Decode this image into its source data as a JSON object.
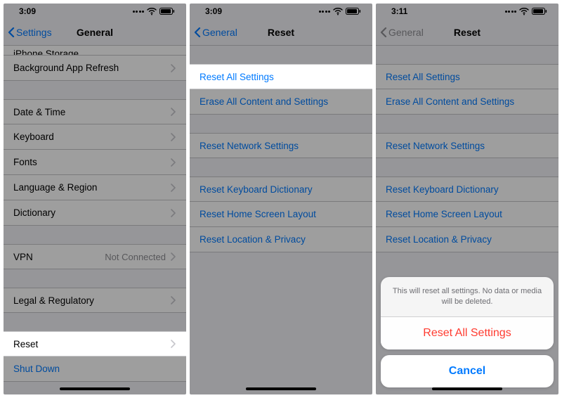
{
  "panel1": {
    "time": "3:09",
    "back_label": "Settings",
    "title": "General",
    "rows": {
      "clipped": "iPhone Storage",
      "bg_refresh": "Background App Refresh",
      "date_time": "Date & Time",
      "keyboard": "Keyboard",
      "fonts": "Fonts",
      "lang_region": "Language & Region",
      "dictionary": "Dictionary",
      "vpn": "VPN",
      "vpn_detail": "Not Connected",
      "legal": "Legal & Regulatory",
      "reset": "Reset",
      "shutdown": "Shut Down"
    }
  },
  "panel2": {
    "time": "3:09",
    "back_label": "General",
    "title": "Reset",
    "rows": {
      "reset_all": "Reset All Settings",
      "erase_all": "Erase All Content and Settings",
      "reset_network": "Reset Network Settings",
      "reset_keyboard": "Reset Keyboard Dictionary",
      "reset_home": "Reset Home Screen Layout",
      "reset_location": "Reset Location & Privacy"
    }
  },
  "panel3": {
    "time": "3:11",
    "back_label": "General",
    "title": "Reset",
    "rows": {
      "reset_all": "Reset All Settings",
      "erase_all": "Erase All Content and Settings",
      "reset_network": "Reset Network Settings",
      "reset_keyboard": "Reset Keyboard Dictionary",
      "reset_home": "Reset Home Screen Layout",
      "reset_location": "Reset Location & Privacy"
    },
    "sheet": {
      "message": "This will reset all settings. No data or media will be deleted.",
      "action": "Reset All Settings",
      "cancel": "Cancel"
    }
  }
}
